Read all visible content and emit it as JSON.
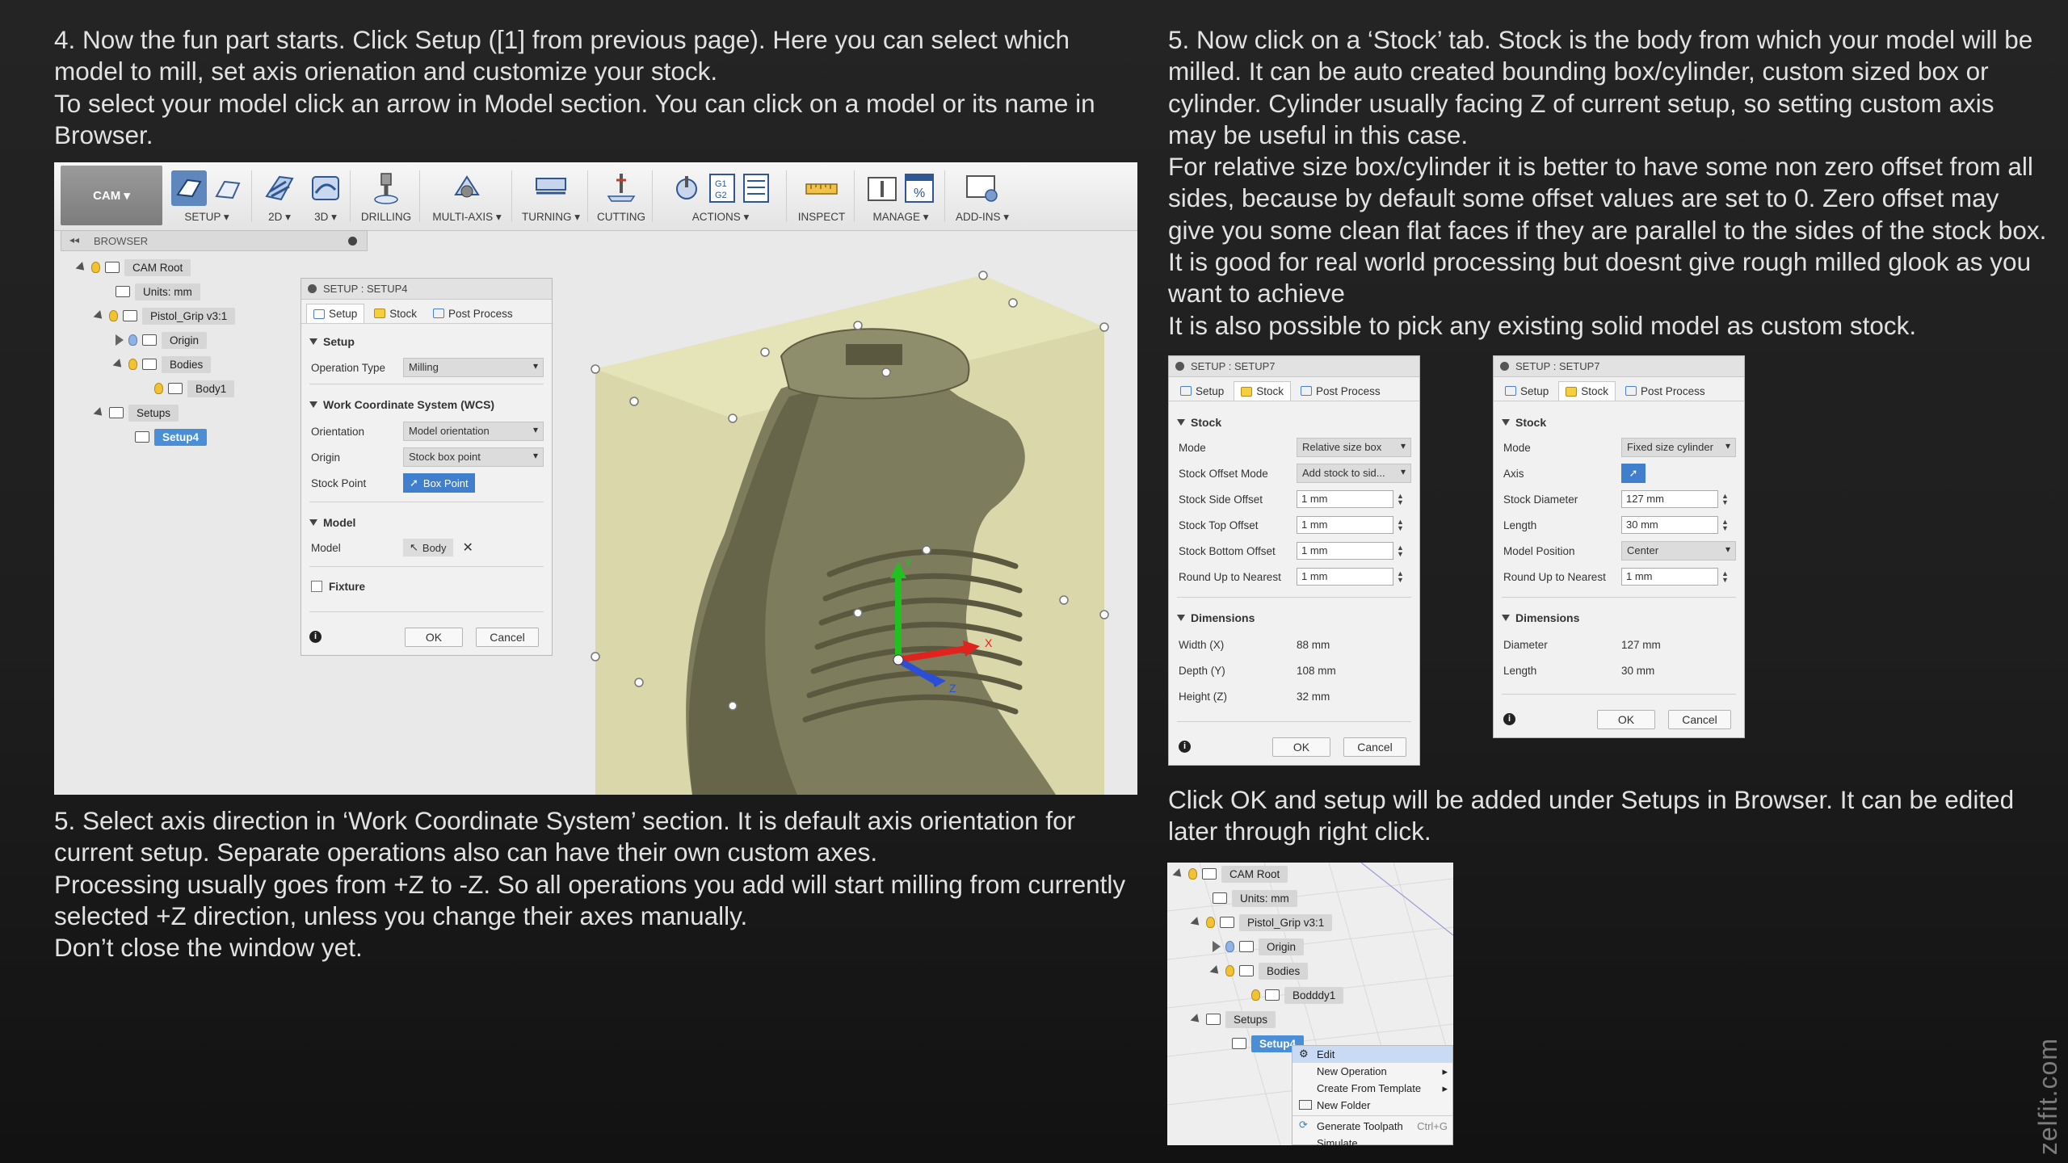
{
  "text": {
    "left_top": [
      "4. Now the fun part starts. Click Setup ([1] from previous page). Here you can select which model to mill, set axis orienation and customize your stock.",
      "To select your model click an arrow in Model section. You can click on a model or its name in Browser."
    ],
    "left_bottom": [
      "5. Select axis direction in ‘Work Coordinate System’ section. It is default axis orientation for current setup. Separate operations also can have their own custom axes.",
      "Processing usually goes from +Z to -Z. So all operations you add will start milling from currently selected +Z direction, unless you change their axes manually.",
      "Don’t close the window yet."
    ],
    "right_top": [
      "5. Now click on a ‘Stock’ tab. Stock is the body from which your model will be milled. It can be auto created bounding box/cylinder, custom sized box or cylinder. Cylinder usually facing Z of current setup, so setting custom axis may be useful in this case.",
      "For relative size box/cylinder it is better to have some non zero offset from all sides, because by default some offset values are set to 0. Zero offset may give you some clean flat faces if they are parallel to the sides of the stock box. It is good for real world processing but doesnt give rough milled glook as you want to achieve",
      "It is also possible to pick any existing solid model as custom stock."
    ],
    "right_mid": [
      "Click OK and setup will be added under Setups in Browser. It can be edited later through right click."
    ],
    "watermark": "zelfit.com"
  },
  "toolbar": {
    "workspace": "CAM ▾",
    "groups": [
      "SETUP ▾",
      "2D ▾",
      "3D ▾",
      "DRILLING",
      "MULTI-AXIS ▾",
      "TURNING ▾",
      "CUTTING",
      "ACTIONS ▾",
      "INSPECT",
      "MANAGE ▾",
      "ADD-INS ▾"
    ]
  },
  "browser": {
    "header": "BROWSER",
    "items": [
      "CAM Root",
      "Units: mm",
      "Pistol_Grip v3:1",
      "Origin",
      "Bodies",
      "Body1",
      "Setups",
      "Setup4"
    ]
  },
  "setup4": {
    "title": "SETUP : SETUP4",
    "tabs": [
      "Setup",
      "Stock",
      "Post Process"
    ],
    "section_setup": "Setup",
    "op_type_label": "Operation Type",
    "op_type_value": "Milling",
    "section_wcs": "Work Coordinate System (WCS)",
    "orientation_label": "Orientation",
    "orientation_value": "Model orientation",
    "origin_label": "Origin",
    "origin_value": "Stock box point",
    "stock_point_label": "Stock Point",
    "stock_point_value": "Box Point",
    "section_model": "Model",
    "model_label": "Model",
    "model_value": "Body",
    "clear_glyph": "✕",
    "fixture_label": "Fixture",
    "ok": "OK",
    "cancel": "Cancel",
    "info": "i"
  },
  "viewport": {
    "axes": [
      "Y",
      "X",
      "Z"
    ],
    "colors": {
      "x": "#e0231f",
      "y": "#1fc21f",
      "z": "#2a4fd6"
    }
  },
  "setup7a": {
    "title": "SETUP : SETUP7",
    "tabs": [
      "Setup",
      "Stock",
      "Post Process"
    ],
    "section_stock": "Stock",
    "mode_label": "Mode",
    "mode_value": "Relative size box",
    "offset_mode_label": "Stock Offset Mode",
    "offset_mode_value": "Add stock to sid...",
    "side_label": "Stock Side Offset",
    "side_value": "1 mm",
    "top_label": "Stock Top Offset",
    "top_value": "1 mm",
    "bottom_label": "Stock Bottom Offset",
    "bottom_value": "1 mm",
    "round_label": "Round Up to Nearest",
    "round_value": "1 mm",
    "section_dim": "Dimensions",
    "width_label": "Width (X)",
    "width_value": "88 mm",
    "depth_label": "Depth (Y)",
    "depth_value": "108 mm",
    "height_label": "Height (Z)",
    "height_value": "32 mm",
    "ok": "OK",
    "cancel": "Cancel",
    "info": "i"
  },
  "setup7b": {
    "title": "SETUP : SETUP7",
    "tabs": [
      "Setup",
      "Stock",
      "Post Process"
    ],
    "section_stock": "Stock",
    "mode_label": "Mode",
    "mode_value": "Fixed size cylinder",
    "axis_label": "Axis",
    "diameter_label": "Stock Diameter",
    "diameter_value": "127 mm",
    "length_label": "Length",
    "length_value": "30 mm",
    "position_label": "Model Position",
    "position_value": "Center",
    "round_label": "Round Up to Nearest",
    "round_value": "1 mm",
    "section_dim": "Dimensions",
    "dia_label": "Diameter",
    "dia_value": "127 mm",
    "len_label": "Length",
    "len_value": "30 mm",
    "ok": "OK",
    "cancel": "Cancel",
    "info": "i"
  },
  "browser2": {
    "items": [
      "CAM Root",
      "Units: mm",
      "Pistol_Grip v3:1",
      "Origin",
      "Bodies",
      "Bodddy1",
      "Setups",
      "Setup4"
    ],
    "menu": [
      "Edit",
      "New Operation",
      "Create From Template",
      "New Folder",
      "Generate Toolpath",
      "Simulate"
    ],
    "shortcut": "Ctrl+G"
  }
}
